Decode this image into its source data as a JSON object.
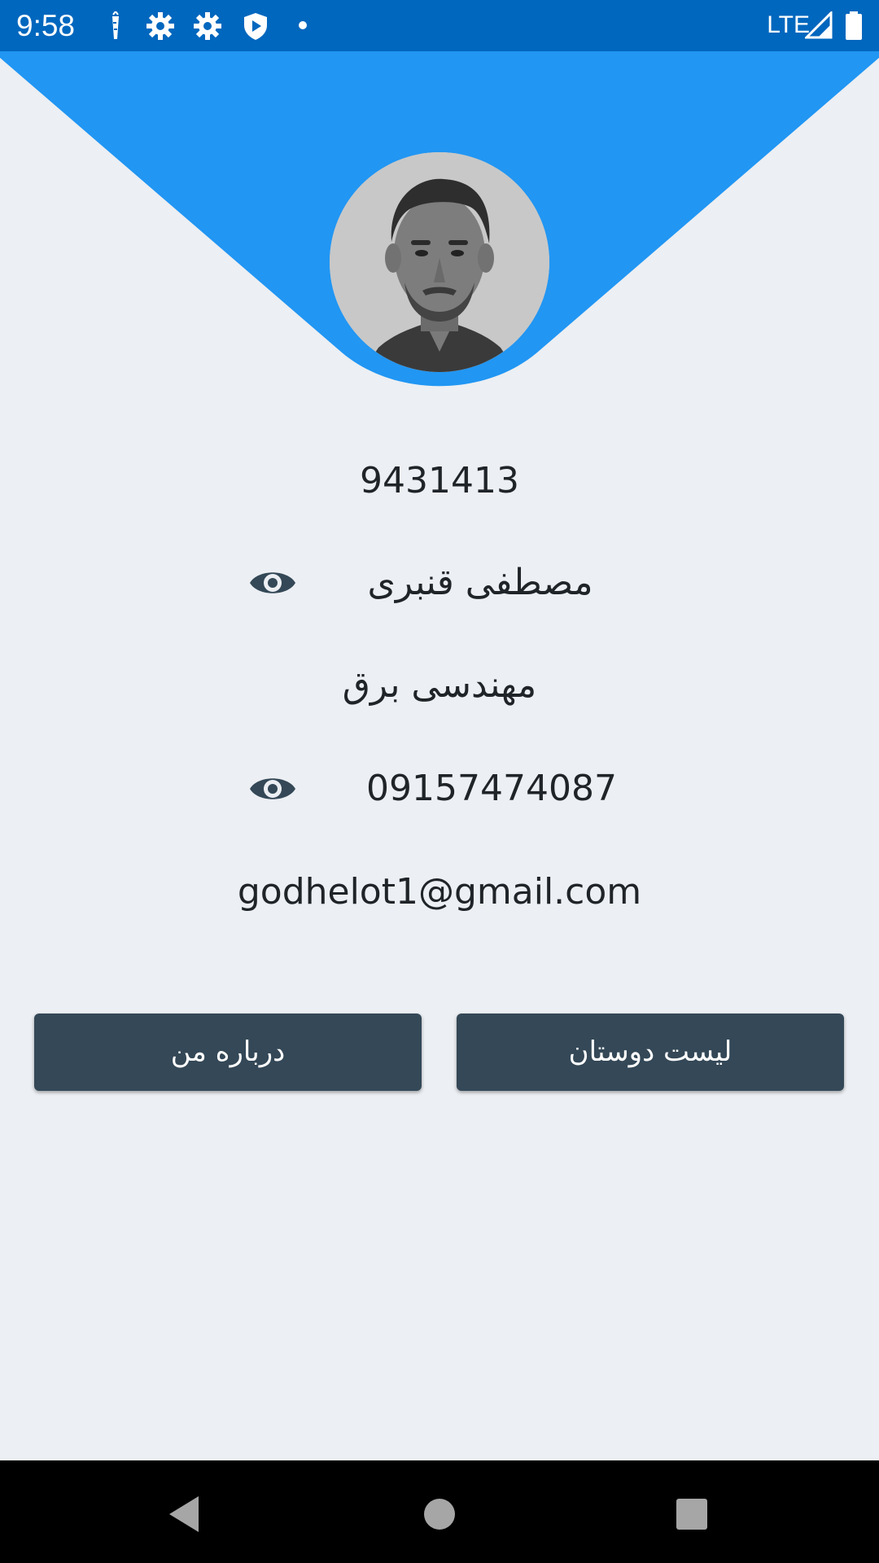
{
  "status_bar": {
    "time": "9:58",
    "network": "LTE",
    "icons": [
      "carrot-icon",
      "gear-icon",
      "gear-icon",
      "play-shield-icon",
      "dot-icon",
      "signal-icon",
      "battery-icon"
    ]
  },
  "profile": {
    "student_id": "9431413",
    "name": "مصطفی قنبری",
    "major": "مهندسی برق",
    "phone": "09157474087",
    "email": "godhelot1@gmail.com"
  },
  "buttons": {
    "friends_list": "لیست دوستان",
    "about_me": "درباره من"
  },
  "colors": {
    "status_bar": "#0067be",
    "header": "#2196f3",
    "background": "#eceff3",
    "button": "#344857",
    "icon": "#344857"
  },
  "nav": {
    "icons": [
      "back-icon",
      "home-icon",
      "recents-icon"
    ]
  }
}
